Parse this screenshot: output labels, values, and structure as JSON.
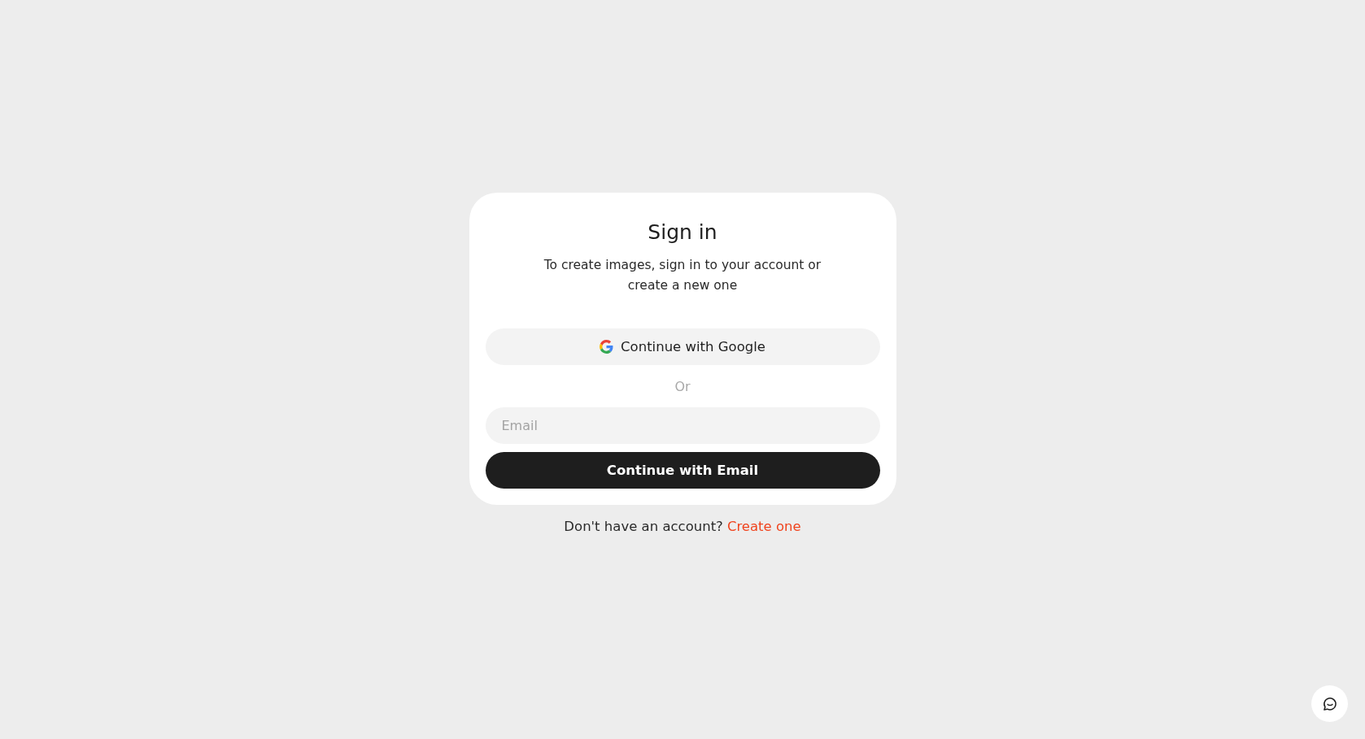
{
  "card": {
    "title": "Sign in",
    "subtitle": "To create images, sign in to your account or create a new one",
    "google_button": "Continue with Google",
    "divider": "Or",
    "email_field": {
      "placeholder": "Email"
    },
    "email_button": "Continue with Email"
  },
  "footer": {
    "text": "Don't have an account?",
    "link": "Create one"
  }
}
